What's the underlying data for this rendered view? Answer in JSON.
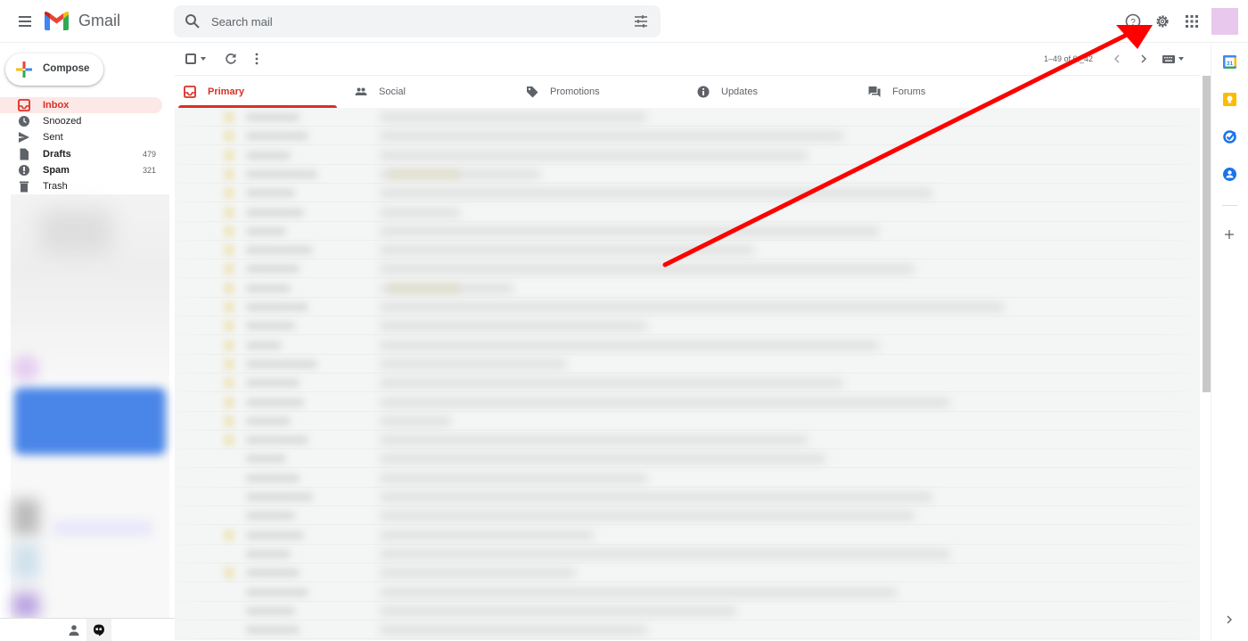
{
  "header": {
    "app_name": "Gmail",
    "search_placeholder": "Search mail",
    "icons": [
      "menu-icon",
      "gmail-logo",
      "search-icon",
      "search-options-icon",
      "help-icon",
      "settings-gear-icon",
      "apps-grid-icon",
      "account-avatar"
    ]
  },
  "sidebar": {
    "compose_label": "Compose",
    "items": [
      {
        "label": "Inbox",
        "count": "",
        "icon": "inbox-icon",
        "active": true
      },
      {
        "label": "Snoozed",
        "count": "",
        "icon": "clock-icon"
      },
      {
        "label": "Sent",
        "count": "",
        "icon": "send-icon"
      },
      {
        "label": "Drafts",
        "count": "479",
        "icon": "draft-icon",
        "bold": true
      },
      {
        "label": "Spam",
        "count": "321",
        "icon": "spam-icon",
        "bold": true
      },
      {
        "label": "Trash",
        "count": "",
        "icon": "trash-icon"
      }
    ]
  },
  "toolbar": {
    "pager_text": "1–49 of 6,_42"
  },
  "tabs": [
    {
      "label": "Primary",
      "icon": "inbox-icon",
      "active": true
    },
    {
      "label": "Social",
      "icon": "people-icon"
    },
    {
      "label": "Promotions",
      "icon": "tag-icon"
    },
    {
      "label": "Updates",
      "icon": "info-icon"
    },
    {
      "label": "Forums",
      "icon": "forum-icon"
    }
  ],
  "colors": {
    "accent_red": "#d93025",
    "active_bg": "#fce8e6",
    "annotation_arrow": "#ff0000"
  },
  "email_list": {
    "note": "content blurred"
  },
  "side_panel": {
    "apps": [
      "calendar-icon",
      "keep-icon",
      "tasks-icon",
      "contacts-icon"
    ]
  }
}
